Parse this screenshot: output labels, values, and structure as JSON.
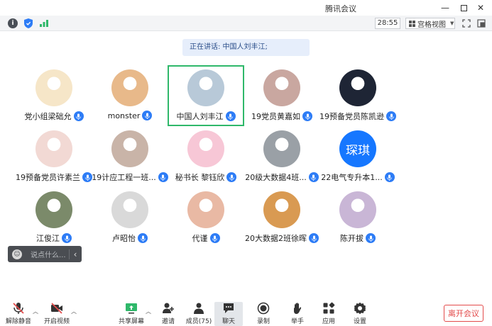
{
  "window": {
    "title": "腾讯会议"
  },
  "toolbar": {
    "timer": "28:55",
    "view_mode": "宫格视图"
  },
  "speaking": {
    "label": "正在讲话: 中国人刘丰江;"
  },
  "participants": [
    {
      "name": "党小组梁础允",
      "avatar_color": "#f6e6c8"
    },
    {
      "name": "monster",
      "avatar_color": "#e8b98a"
    },
    {
      "name": "中国人刘丰江",
      "avatar_color": "#b8c9d8"
    },
    {
      "name": "19党员黄嘉如",
      "avatar_color": "#c9a7a0"
    },
    {
      "name": "19预备党员陈凯逊",
      "avatar_color": "#1e2535"
    },
    {
      "name": "19预备党员许素兰",
      "avatar_color": "#f2d9d4"
    },
    {
      "name": "19计应工程一班...",
      "avatar_color": "#c9b4a8"
    },
    {
      "name": "秘书长 黎钰欣",
      "avatar_color": "#f7c7d6"
    },
    {
      "name": "20级大数据4班...",
      "avatar_color": "#9aa0a6"
    },
    {
      "name": "22电气专升本1...",
      "avatar_text": "琛琪",
      "avatar_color": "#1677ff"
    },
    {
      "name": "江俊江",
      "avatar_color": "#7b8a6a"
    },
    {
      "name": "卢昭怡",
      "avatar_color": "#d9d9d9"
    },
    {
      "name": "代谨",
      "avatar_color": "#e9b9a4"
    },
    {
      "name": "20大数据2班徐晖",
      "avatar_color": "#d99a52"
    },
    {
      "name": "陈开拔",
      "avatar_color": "#c9b6d6"
    }
  ],
  "chat": {
    "placeholder": "说点什么..."
  },
  "bottom": {
    "unmute": "解除静音",
    "video": "开启视频",
    "share": "共享屏幕",
    "invite": "邀请",
    "members": "成员(75)",
    "chat": "聊天",
    "record": "录制",
    "raise": "举手",
    "apps": "应用",
    "settings": "设置",
    "leave": "离开会议"
  },
  "colors": {
    "accent": "#2d7cf6",
    "active_border": "#2fb86a",
    "danger": "#e34b4b"
  }
}
